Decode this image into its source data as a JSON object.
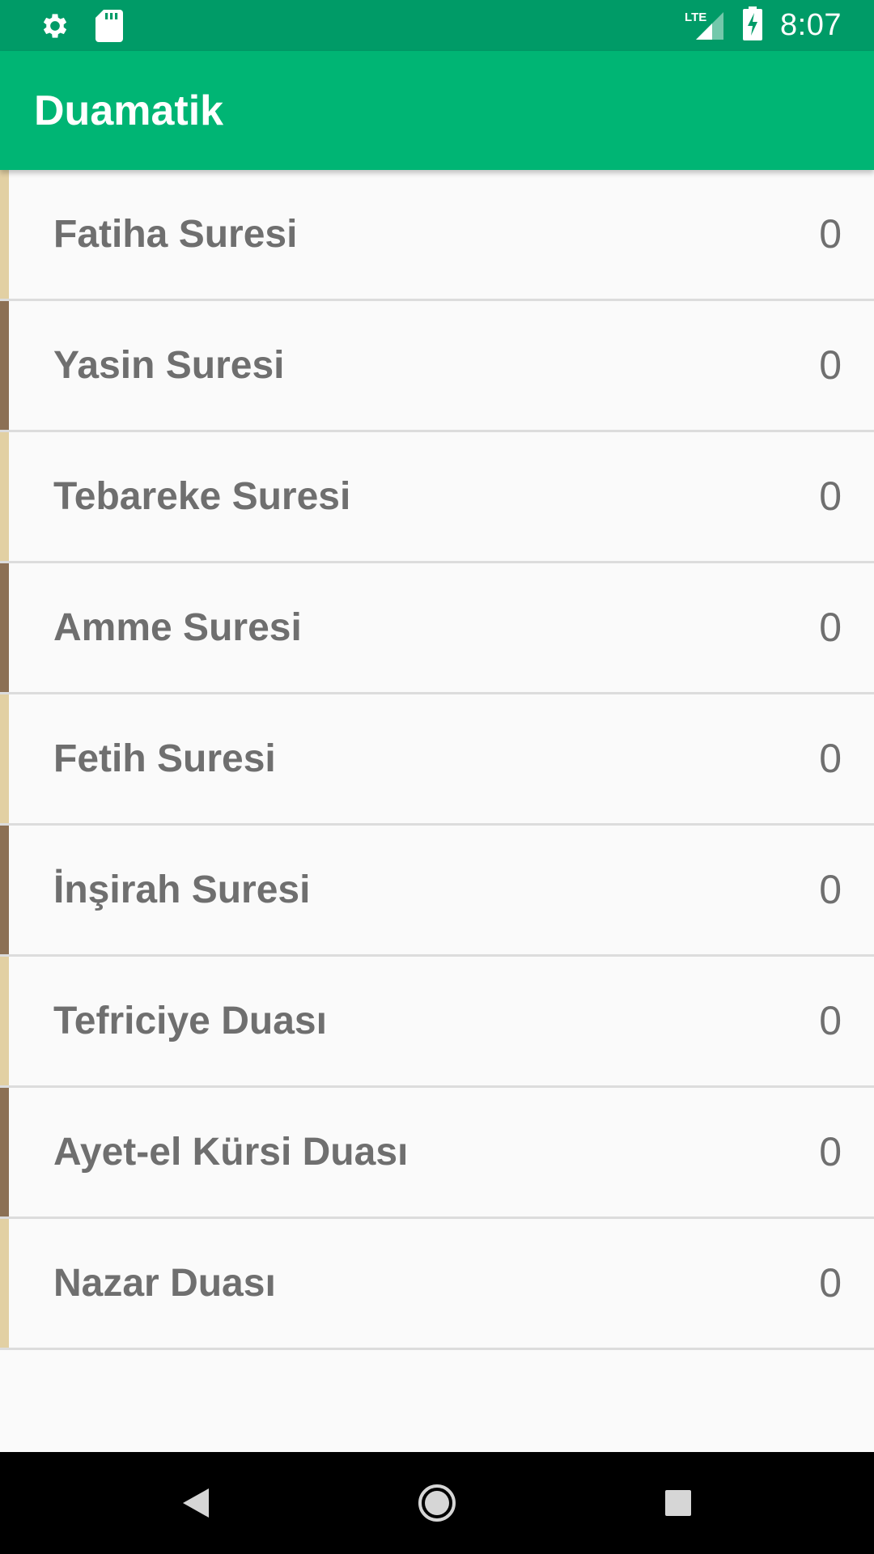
{
  "status_bar": {
    "time": "8:07",
    "network_label": "LTE",
    "icons": [
      "gear-icon",
      "sd-card-icon",
      "lte-signal-icon",
      "battery-charging-icon"
    ]
  },
  "app_bar": {
    "title": "Duamatik"
  },
  "list": {
    "items": [
      {
        "name": "Fatiha Suresi",
        "count": "0"
      },
      {
        "name": "Yasin Suresi",
        "count": "0"
      },
      {
        "name": "Tebareke Suresi",
        "count": "0"
      },
      {
        "name": "Amme Suresi",
        "count": "0"
      },
      {
        "name": "Fetih Suresi",
        "count": "0"
      },
      {
        "name": "İnşirah Suresi",
        "count": "0"
      },
      {
        "name": "Tefriciye Duası",
        "count": "0"
      },
      {
        "name": "Ayet-el Kürsi Duası",
        "count": "0"
      },
      {
        "name": "Nazar Duası",
        "count": "0"
      }
    ]
  },
  "nav_bar": {
    "icons": [
      "back-icon",
      "home-icon",
      "recents-icon"
    ]
  },
  "colors": {
    "status_bar": "#009b67",
    "app_bar": "#00b574",
    "stripe_light": "#e2d0a3",
    "stripe_dark": "#8c7054",
    "text": "#6f6f6f",
    "background": "#fafafa"
  }
}
